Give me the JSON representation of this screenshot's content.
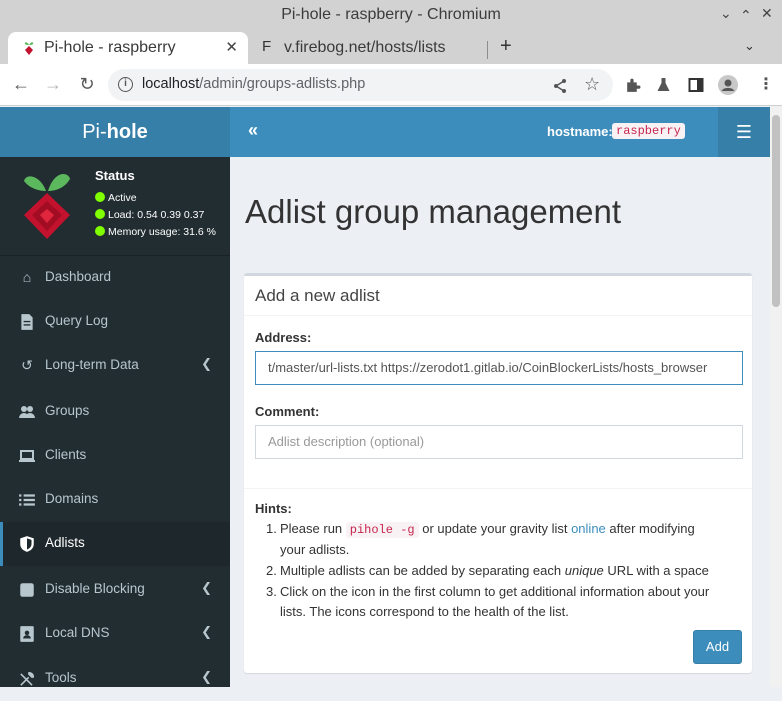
{
  "window": {
    "title": "Pi-hole - raspberry - Chromium"
  },
  "tabs": [
    {
      "label": "Pi-hole - raspberry",
      "active": true
    },
    {
      "label": "v.firebog.net/hosts/lists",
      "active": false
    }
  ],
  "address_bar": {
    "host": "localhost",
    "path": "/admin/groups-adlists.php"
  },
  "app": {
    "logo_prefix": "Pi-",
    "logo_suffix": "hole",
    "hostname_label": "hostname:",
    "hostname_value": "raspberry"
  },
  "status": {
    "title": "Status",
    "active": "Active",
    "load": "Load:  0.54  0.39  0.37",
    "memory": "Memory usage:  31.6 %",
    "indicator_color": "#7fff00"
  },
  "nav": [
    {
      "label": "Dashboard",
      "icon": "home-icon"
    },
    {
      "label": "Query Log",
      "icon": "file-icon"
    },
    {
      "label": "Long-term Data",
      "icon": "history-icon",
      "submenu": true
    },
    {
      "label": "Groups",
      "icon": "users-icon"
    },
    {
      "label": "Clients",
      "icon": "laptop-icon"
    },
    {
      "label": "Domains",
      "icon": "list-icon"
    },
    {
      "label": "Adlists",
      "icon": "shield-icon",
      "active": true
    },
    {
      "label": "Disable Blocking",
      "icon": "stop-icon",
      "submenu": true
    },
    {
      "label": "Local DNS",
      "icon": "address-book-icon",
      "submenu": true
    },
    {
      "label": "Tools",
      "icon": "tools-icon",
      "submenu": true
    }
  ],
  "main": {
    "page_title": "Adlist group management",
    "box_title": "Add a new adlist",
    "address_label": "Address:",
    "address_value": "t/master/url-lists.txt  https://zerodot1.gitlab.io/CoinBlockerLists/hosts_browser",
    "comment_label": "Comment:",
    "comment_placeholder": "Adlist description (optional)",
    "hints_title": "Hints:",
    "hint1_a": "Please run",
    "hint1_code": "pihole -g",
    "hint1_b": "or update your gravity list",
    "hint1_link": "online",
    "hint1_c": "after modifying",
    "hint1_d": "your adlists.",
    "hint2_a": "Multiple adlists can be added by separating each",
    "hint2_em": "unique",
    "hint2_b": "URL with a space",
    "hint3_a": "Click on the icon in the first column to get additional information about your",
    "hint3_b": "lists. The icons correspond to the health of the list.",
    "add_button": "Add"
  },
  "colors": {
    "primary": "#3c8dbc",
    "sidebar": "#222d32",
    "code_text": "#c7254e"
  }
}
